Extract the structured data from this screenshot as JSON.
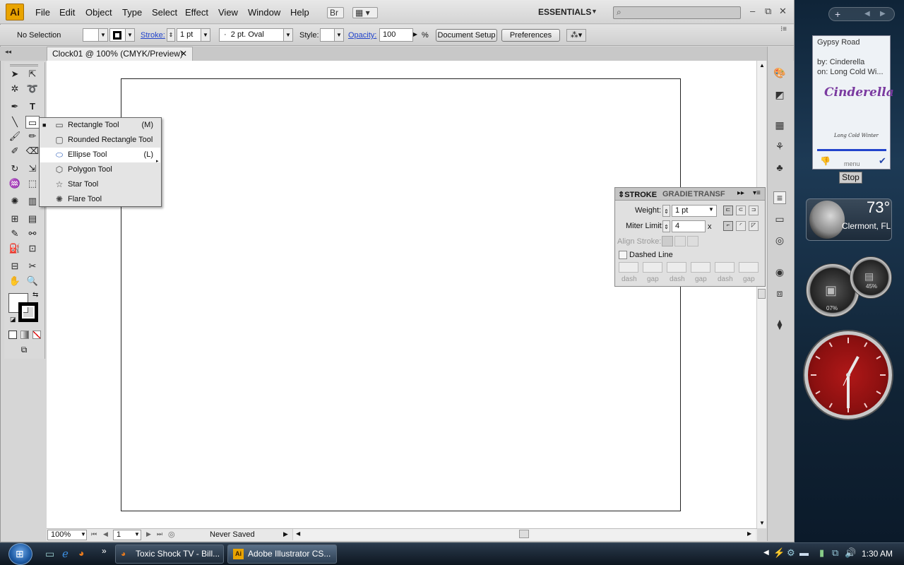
{
  "app": {
    "logo": "Ai",
    "menus": [
      "File",
      "Edit",
      "Object",
      "Type",
      "Select",
      "Effect",
      "View",
      "Window",
      "Help"
    ],
    "bridge_label": "Br",
    "workspace": "ESSENTIALS"
  },
  "control_bar": {
    "selection": "No Selection",
    "stroke_label": "Stroke:",
    "stroke_weight": "1 pt",
    "brush": "2 pt. Oval",
    "style_label": "Style:",
    "opacity_label": "Opacity:",
    "opacity_value": "100",
    "percent": "%",
    "document_setup": "Document Setup",
    "preferences": "Preferences"
  },
  "document": {
    "tab_title": "Clock01 @ 100% (CMYK/Preview)",
    "zoom": "100%",
    "artboard": "1",
    "status": "Never Saved"
  },
  "flyout": {
    "items": [
      {
        "label": "Rectangle Tool",
        "shortcut": "(M)",
        "icon": "rectangle-icon"
      },
      {
        "label": "Rounded Rectangle Tool",
        "shortcut": "",
        "icon": "rounded-rectangle-icon"
      },
      {
        "label": "Ellipse Tool",
        "shortcut": "(L)",
        "icon": "ellipse-icon"
      },
      {
        "label": "Polygon Tool",
        "shortcut": "",
        "icon": "polygon-icon"
      },
      {
        "label": "Star Tool",
        "shortcut": "",
        "icon": "star-icon"
      },
      {
        "label": "Flare Tool",
        "shortcut": "",
        "icon": "flare-icon"
      }
    ],
    "selected_index": 2
  },
  "stroke_panel": {
    "tabs": [
      "STROKE",
      "GRADIE",
      "TRANSF"
    ],
    "weight_label": "Weight:",
    "weight_value": "1 pt",
    "miter_label": "Miter Limit:",
    "miter_value": "4",
    "miter_unit": "x",
    "align_label": "Align Stroke:",
    "dashed_label": "Dashed Line",
    "dash_labels": [
      "dash",
      "gap",
      "dash",
      "gap",
      "dash",
      "gap"
    ]
  },
  "gadgets": {
    "music": {
      "title": "Gypsy Road",
      "artist": "by: Cinderella",
      "album": "on: Long Cold Wi...",
      "logo_text": "Cinderella",
      "album_art_text": "Long Cold Winter",
      "menu_label": "menu",
      "stop_label": "Stop"
    },
    "weather": {
      "temp": "73°",
      "city": "Clermont, FL"
    },
    "meter": {
      "cpu": "07%",
      "memory": "45%"
    }
  },
  "taskbar": {
    "tasks": [
      "Toxic Shock TV - Bill...",
      "Adobe Illustrator CS..."
    ],
    "time": "1:30 AM"
  },
  "colors": {
    "accent": "#e9a400",
    "clock_face": "#a01414",
    "selection_blue": "#2244cc"
  }
}
